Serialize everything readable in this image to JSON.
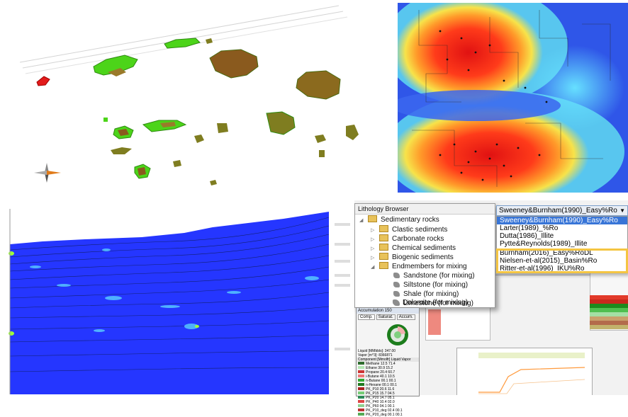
{
  "lithology_browser": {
    "title": "Lithology Browser",
    "root": "Sedimentary rocks",
    "groups": [
      "Clastic sediments",
      "Carbonate rocks",
      "Chemical sediments",
      "Biogenic sediments",
      "Endmembers for mixing"
    ],
    "endmembers": [
      "Sandstone (for mixing)",
      "Siltstone (for mixing)",
      "Shale (for mixing)",
      "Limestone (for mixing)",
      "Dolomite (for mixing)"
    ]
  },
  "kinetics": {
    "selected": "Sweeney&Burnham(1990)_Easy%Ro",
    "options": [
      "Sweeney&Burnham(1990)_Easy%Ro",
      "Larter(1989)_%Ro",
      "Dutta(1986)_Illite",
      "Pytte&Reynolds(1989)_Illite",
      "Burnham(2016)_Easy%RoDL",
      "Nielsen-et-al(2015)_Basin%Ro",
      "Ritter-et-al(1996)_IKU%Ro"
    ]
  },
  "accumulation": {
    "title": "Accumulation 150",
    "tabs": [
      "Comp.",
      "Saturat.",
      "Accum."
    ],
    "liquid_label": "Liquid [MMbbls]:",
    "liquid_value": "347.00",
    "vapor_label": "Vapor [m^3]:",
    "vapor_value": "8366871",
    "col_headers": [
      "Component",
      "[Mmolfr]",
      "Liquid Vapor"
    ],
    "components": [
      {
        "name": "Methane",
        "v": "12.5  71.4"
      },
      {
        "name": "Ethane",
        "v": "30.9  15.2"
      },
      {
        "name": "Propane",
        "v": "20.4  60.7"
      },
      {
        "name": "i-Butane",
        "v": "40.1  10.5"
      },
      {
        "name": "n-Butane",
        "v": "00.1  00.1"
      },
      {
        "name": "n-Hexane",
        "v": "00.1  00.1"
      },
      {
        "name": "PK_P10",
        "v": "20.6  11.6"
      },
      {
        "name": "PK_P15",
        "v": "15.7  04.5"
      },
      {
        "name": "PK_P20",
        "v": "14.7  05.1"
      },
      {
        "name": "PK_P40",
        "v": "10.4  02.0"
      },
      {
        "name": "PK_P60",
        "v": "04.1  00.1"
      },
      {
        "name": "PK_P10_deg",
        "v": "02.4  00.1"
      },
      {
        "name": "PK_P20_deg",
        "v": "00.1  00.1"
      }
    ],
    "comp_colors": [
      "#2d6b2d",
      "#b3e6b3",
      "#cc3333",
      "#ee7777",
      "#33aa33",
      "#1f7a1f",
      "#aa2222",
      "#77cc77",
      "#2e8b57",
      "#dd4444",
      "#8fd18f",
      "#bb3333",
      "#55aa55"
    ]
  },
  "right_colors": {
    "table_reds": [
      "#e23a2a",
      "#c8281d",
      "#f17a6b",
      "#d9483a",
      "#a61f16"
    ],
    "legend_greens": [
      "#1d8a1d",
      "#4fbf4f",
      "#a4e0a4",
      "#2e9e2e",
      "#c9a06b",
      "#b36b4b",
      "#c2b26b"
    ]
  }
}
